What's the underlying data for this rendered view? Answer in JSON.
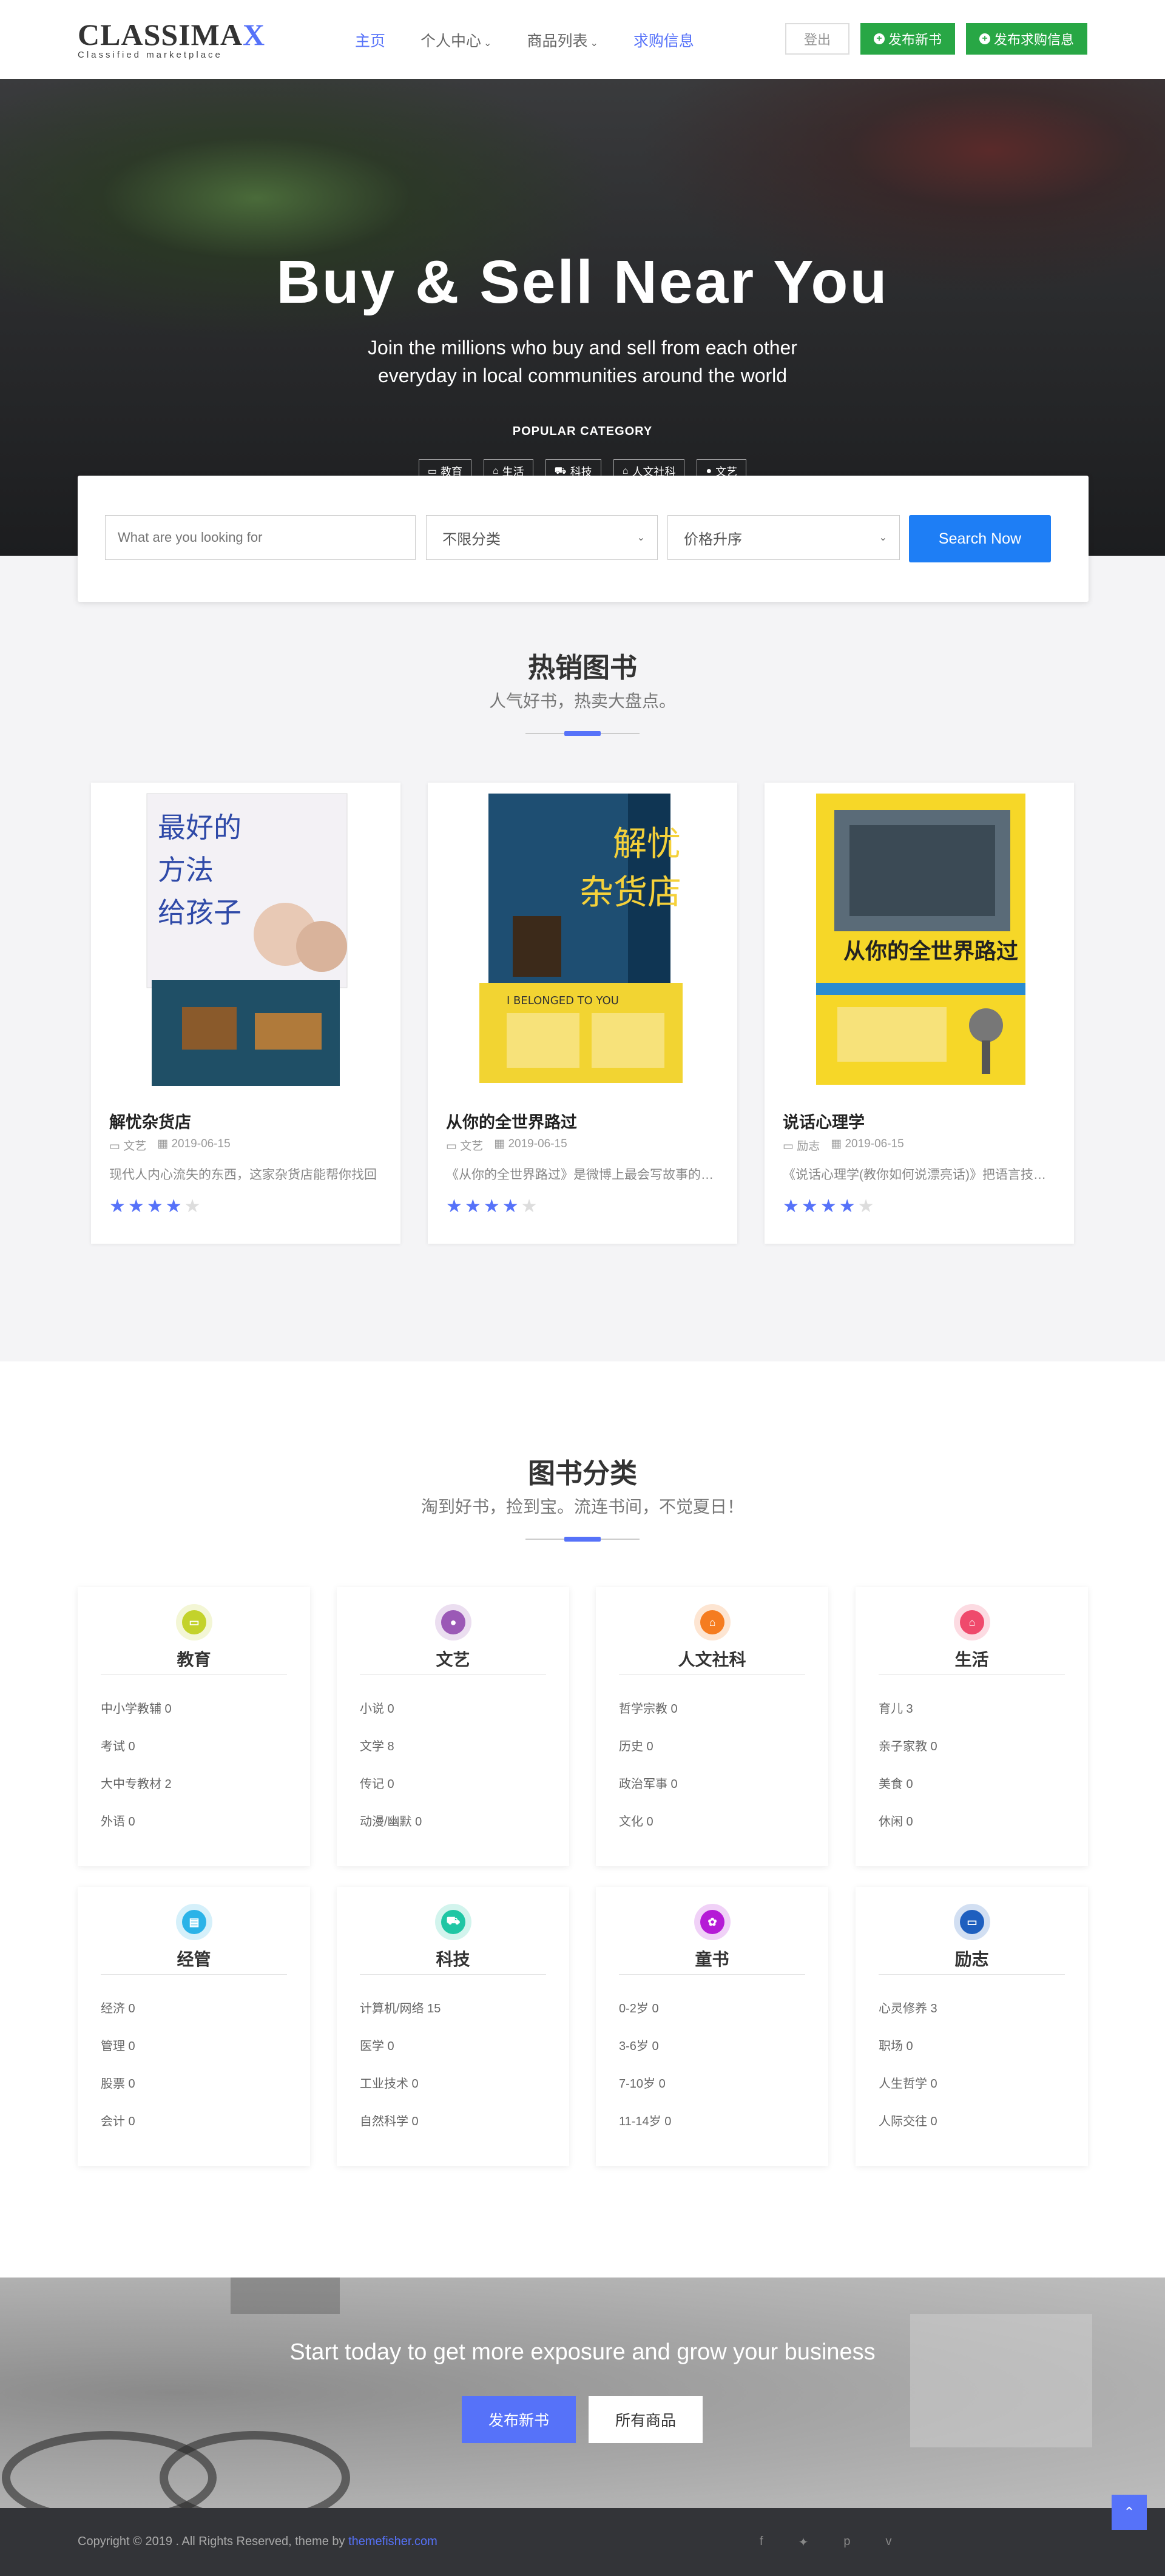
{
  "header": {
    "logo_main": "CLASSIMA",
    "logo_x": "X",
    "logo_sub": "Classified marketplace",
    "menu": [
      {
        "label": "主页",
        "caret": ""
      },
      {
        "label": "个人中心",
        "caret": "⌄"
      },
      {
        "label": "商品列表",
        "caret": "⌄"
      },
      {
        "label": "求购信息",
        "caret": ""
      }
    ],
    "logout_label": "登出",
    "publish_new_label": "发布新书",
    "publish_wanted_label": "发布求购信息"
  },
  "hero": {
    "title": "Buy & Sell Near You",
    "subtitle": "Join the millions who buy and sell from each other everyday in local communities around the world",
    "popular_label": "POPULAR CATEGORY",
    "categories": [
      {
        "icon": "laptop-icon",
        "glyph": "▭",
        "label": "教育"
      },
      {
        "icon": "store-icon",
        "glyph": "⌂",
        "label": "生活"
      },
      {
        "icon": "car-icon",
        "glyph": "⛟",
        "label": "科技"
      },
      {
        "icon": "home-icon",
        "glyph": "⌂",
        "label": "人文社科"
      },
      {
        "icon": "apple-icon",
        "glyph": "●",
        "label": "文艺"
      }
    ]
  },
  "search": {
    "placeholder": "What are you looking for",
    "category_select": "不限分类",
    "sort_select": "价格升序",
    "button_label": "Search Now"
  },
  "hot_books": {
    "title": "热销图书",
    "subtitle": "人气好书，热卖大盘点。",
    "books": [
      {
        "name": "解忧杂货店",
        "category": "文艺",
        "date": "2019-06-15",
        "desc": "现代人内心流失的东西，这家杂货店能帮你找回",
        "rating": 4
      },
      {
        "name": "从你的全世界路过",
        "category": "文艺",
        "date": "2019-06-15",
        "desc": "《从你的全世界路过》是微博上最会写故事的张嘉佳",
        "rating": 4
      },
      {
        "name": "说话心理学",
        "category": "励志",
        "date": "2019-06-15",
        "desc": "《说话心理学(教你如何说漂亮话)》把语言技巧和心理学",
        "rating": 4
      }
    ]
  },
  "book_categories": {
    "title": "图书分类",
    "subtitle": "淘到好书，捡到宝。流连书间，不觉夏日！",
    "cards": [
      {
        "name": "教育",
        "color": "#c3d22b",
        "glyph": "▭",
        "icon": "laptop-icon",
        "items": [
          "中小学教辅 0",
          "考试 0",
          "大中专教材 2",
          "外语 0"
        ]
      },
      {
        "name": "文艺",
        "color": "#9b59b6",
        "glyph": "●",
        "icon": "apple-icon",
        "items": [
          "小说 0",
          "文学 8",
          "传记 0",
          "动漫/幽默 0"
        ]
      },
      {
        "name": "人文社科",
        "color": "#f57c20",
        "glyph": "⌂",
        "icon": "home-icon",
        "items": [
          "哲学宗教 0",
          "历史 0",
          "政治军事 0",
          "文化 0"
        ]
      },
      {
        "name": "生活",
        "color": "#ef4a6c",
        "glyph": "⌂",
        "icon": "store-icon",
        "items": [
          "育儿 3",
          "亲子家教 0",
          "美食 0",
          "休闲 0"
        ]
      },
      {
        "name": "经管",
        "color": "#2bb3e8",
        "glyph": "▤",
        "icon": "briefcase-icon",
        "items": [
          "经济 0",
          "管理 0",
          "股票 0",
          "会计 0"
        ]
      },
      {
        "name": "科技",
        "color": "#1fc6a4",
        "glyph": "⛟",
        "icon": "car-icon",
        "items": [
          "计算机/网络 15",
          "医学 0",
          "工业技术 0",
          "自然科学 0"
        ]
      },
      {
        "name": "童书",
        "color": "#b51bd6",
        "glyph": "✿",
        "icon": "paw-icon",
        "items": [
          "0-2岁 0",
          "3-6岁 0",
          "7-10岁 0",
          "11-14岁 0"
        ]
      },
      {
        "name": "励志",
        "color": "#1e5fbf",
        "glyph": "▭",
        "icon": "laptop-icon",
        "items": [
          "心灵修养 3",
          "职场 0",
          "人生哲学 0",
          "人际交往 0"
        ]
      }
    ]
  },
  "cta": {
    "title": "Start today to get more exposure and grow your business",
    "btn_publish": "发布新书",
    "btn_all": "所有商品"
  },
  "footer": {
    "copyright_prefix": "Copyright © 2019 . All Rights Reserved, theme by ",
    "copyright_link": "themefisher.com",
    "socials": [
      {
        "icon": "facebook-icon",
        "glyph": "f"
      },
      {
        "icon": "twitter-icon",
        "glyph": "✦"
      },
      {
        "icon": "pinterest-icon",
        "glyph": "p"
      },
      {
        "icon": "vimeo-icon",
        "glyph": "v"
      }
    ],
    "to_top_glyph": "⌃"
  }
}
